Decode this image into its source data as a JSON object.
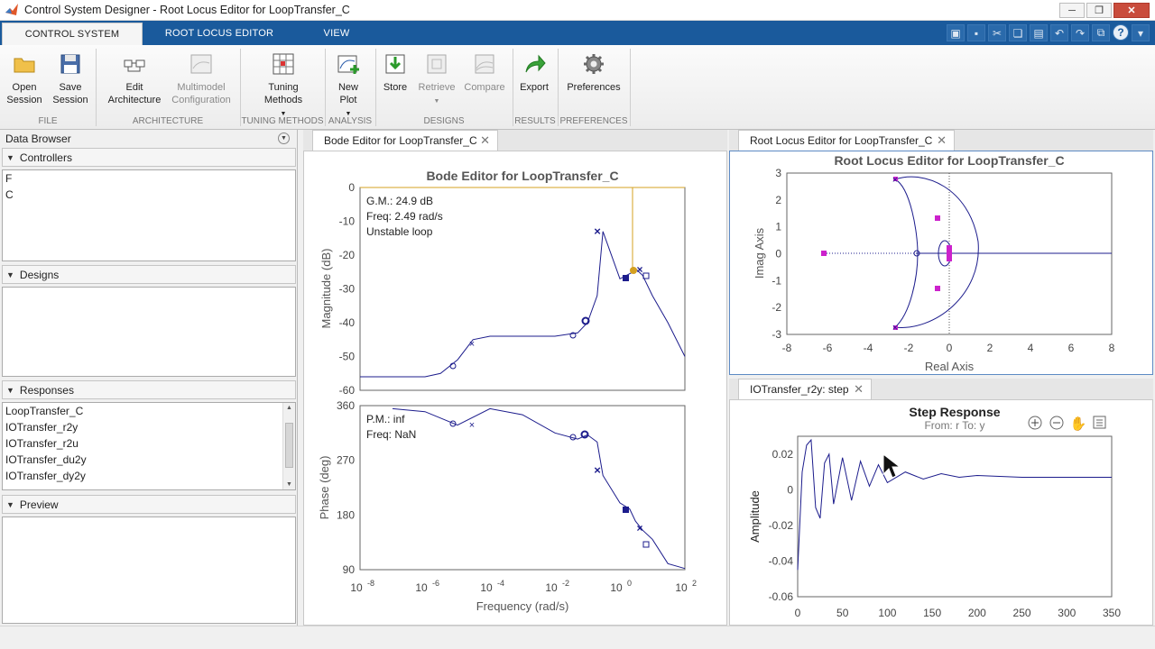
{
  "window": {
    "title": "Control System Designer - Root Locus Editor for LoopTransfer_C"
  },
  "tabs": [
    {
      "label": "CONTROL SYSTEM"
    },
    {
      "label": "ROOT LOCUS EDITOR"
    },
    {
      "label": "VIEW"
    }
  ],
  "ribbon": {
    "open_session": "Open\nSession",
    "save_session": "Save\nSession",
    "edit_architecture": "Edit\nArchitecture",
    "multimodel": "Multimodel\nConfiguration",
    "tuning_methods": "Tuning\nMethods",
    "new_plot": "New\nPlot",
    "store": "Store",
    "retrieve": "Retrieve",
    "compare": "Compare",
    "export": "Export",
    "preferences": "Preferences",
    "groups": [
      "FILE",
      "ARCHITECTURE",
      "TUNING METHODS",
      "ANALYSIS",
      "DESIGNS",
      "RESULTS",
      "PREFERENCES"
    ]
  },
  "data_browser": {
    "title": "Data Browser",
    "controllers_label": "Controllers",
    "controllers": [
      "F",
      "C"
    ],
    "designs_label": "Designs",
    "responses_label": "Responses",
    "responses": [
      "LoopTransfer_C",
      "IOTransfer_r2y",
      "IOTransfer_r2u",
      "IOTransfer_du2y",
      "IOTransfer_dy2y"
    ],
    "preview_label": "Preview"
  },
  "bode": {
    "tab_label": "Bode Editor for LoopTransfer_C",
    "title": "Bode Editor for LoopTransfer_C",
    "gm_text": "G.M.: 24.9 dB",
    "gm_freq": "Freq: 2.49 rad/s",
    "stability": "Unstable loop",
    "pm_text": "P.M.: inf",
    "pm_freq": "Freq: NaN",
    "mag_ylabel": "Magnitude (dB)",
    "phase_ylabel": "Phase (deg)",
    "xlabel": "Frequency (rad/s)",
    "mag_ticks": [
      "0",
      "-10",
      "-20",
      "-30",
      "-40",
      "-50",
      "-60"
    ],
    "phase_ticks": [
      "360",
      "270",
      "180",
      "90"
    ],
    "x_tick_base": [
      "10",
      "10",
      "10",
      "10",
      "10"
    ],
    "x_tick_exp": [
      "-8",
      "-6",
      "-4",
      "-2",
      "0",
      "2"
    ]
  },
  "rootlocus": {
    "tab_label": "Root Locus Editor for LoopTransfer_C",
    "title": "Root Locus Editor for LoopTransfer_C",
    "xlabel": "Real Axis",
    "ylabel": "Imag Axis",
    "x_ticks": [
      "-8",
      "-6",
      "-4",
      "-2",
      "0",
      "2",
      "4",
      "6",
      "8"
    ],
    "y_ticks": [
      "3",
      "2",
      "1",
      "0",
      "-1",
      "-2",
      "-3"
    ]
  },
  "step": {
    "tab_label": "IOTransfer_r2y: step",
    "title": "Step Response",
    "subtitle": "From: r  To: y",
    "ylabel": "Amplitude",
    "x_ticks": [
      "0",
      "50",
      "100",
      "150",
      "200",
      "250",
      "300",
      "350"
    ],
    "y_ticks": [
      "0.02",
      "0",
      "-0.02",
      "-0.04",
      "-0.06"
    ]
  },
  "colors": {
    "ribbon_tab_blue": "#1a5a9c",
    "curve": "#1c1c8c",
    "magenta": "#cc22cc",
    "orange": "#d4a020"
  },
  "chart_data": [
    {
      "type": "line",
      "title": "Bode Editor for LoopTransfer_C",
      "xlabel": "Frequency (rad/s)",
      "ylabel": "Magnitude (dB)",
      "xscale": "log",
      "xlim": [
        1e-08,
        100
      ],
      "ylim": [
        -60,
        0
      ],
      "x": [
        1e-08,
        1e-07,
        1e-06,
        3e-06,
        1e-05,
        3e-05,
        0.0001,
        0.001,
        0.01,
        0.05,
        0.1,
        0.2,
        0.3,
        1,
        2.49,
        3,
        5,
        10,
        30,
        100
      ],
      "series": [
        {
          "values": [
            -56,
            -56,
            -56,
            -55,
            -51,
            -45,
            -44,
            -44,
            -44,
            -43,
            -40,
            -32,
            -13,
            -27,
            -25,
            -24,
            -26,
            -32,
            -40,
            -50
          ]
        }
      ],
      "grid": false
    },
    {
      "type": "line",
      "xlabel": "Frequency (rad/s)",
      "ylabel": "Phase (deg)",
      "xscale": "log",
      "xlim": [
        1e-08,
        100
      ],
      "ylim": [
        90,
        360
      ],
      "x": [
        1e-07,
        1e-06,
        1e-05,
        0.0001,
        0.001,
        0.01,
        0.05,
        0.1,
        0.2,
        0.3,
        1,
        2,
        3,
        5,
        10,
        30,
        100
      ],
      "series": [
        {
          "values": [
            355,
            350,
            328,
            355,
            345,
            315,
            305,
            312,
            300,
            245,
            200,
            190,
            170,
            155,
            140,
            100,
            92
          ]
        }
      ],
      "grid": false
    },
    {
      "type": "scatter",
      "title": "Root Locus Editor for LoopTransfer_C",
      "xlabel": "Real Axis",
      "ylabel": "Imag Axis",
      "xlim": [
        -8,
        8
      ],
      "ylim": [
        -3,
        3
      ],
      "poles": [
        {
          "x": -6.2,
          "y": 0
        },
        {
          "x": -2.6,
          "y": 2.8
        },
        {
          "x": -2.6,
          "y": -2.8
        },
        {
          "x": -0.6,
          "y": 1.3
        },
        {
          "x": -0.6,
          "y": -1.3
        }
      ],
      "grid": false
    },
    {
      "type": "line",
      "title": "Step Response",
      "ylabel": "Amplitude",
      "xlim": [
        0,
        350
      ],
      "ylim": [
        -0.06,
        0.03
      ],
      "x": [
        0,
        5,
        10,
        15,
        20,
        25,
        30,
        35,
        40,
        50,
        60,
        70,
        80,
        90,
        100,
        120,
        140,
        160,
        180,
        200,
        250,
        300,
        350
      ],
      "series": [
        {
          "values": [
            -0.045,
            0.01,
            0.025,
            0.028,
            -0.01,
            -0.016,
            0.015,
            0.02,
            -0.008,
            0.018,
            -0.006,
            0.016,
            0.002,
            0.014,
            0.004,
            0.01,
            0.006,
            0.009,
            0.007,
            0.008,
            0.007,
            0.007,
            0.007
          ]
        }
      ],
      "grid": false
    }
  ]
}
